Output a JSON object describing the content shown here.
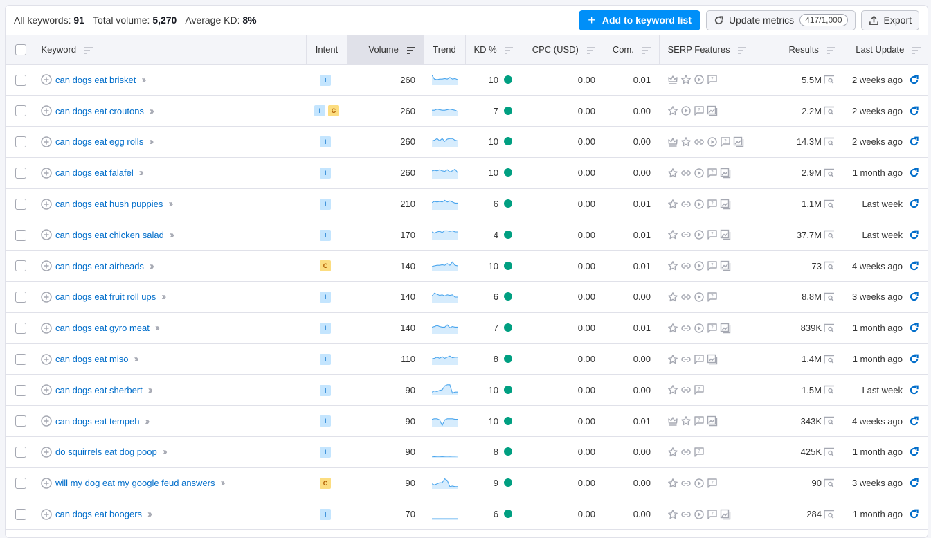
{
  "summary": {
    "all_keywords_label": "All keywords:",
    "all_keywords_value": "91",
    "total_volume_label": "Total volume:",
    "total_volume_value": "5,270",
    "avg_kd_label": "Average KD:",
    "avg_kd_value": "8%"
  },
  "actions": {
    "add_to_list": "Add to keyword list",
    "update_metrics": "Update metrics",
    "update_counter": "417/1,000",
    "export": "Export"
  },
  "columns": {
    "keyword": "Keyword",
    "intent": "Intent",
    "volume": "Volume",
    "trend": "Trend",
    "kd": "KD %",
    "cpc": "CPC (USD)",
    "com": "Com.",
    "serp": "SERP Features",
    "results": "Results",
    "last_update": "Last Update"
  },
  "sorted_column": "volume",
  "colors": {
    "accent": "#008ff8",
    "link": "#006dca",
    "kd_easy": "#009f81",
    "intent_informational_bg": "#c4e5fe",
    "intent_commercial_bg": "#fcdd80"
  },
  "rows": [
    {
      "keyword": "can dogs eat brisket",
      "intent": [
        "I"
      ],
      "volume": "260",
      "trend": [
        0.9,
        0.55,
        0.5,
        0.55,
        0.55,
        0.6,
        0.55,
        0.7,
        0.55,
        0.6,
        0.5
      ],
      "kd": "10",
      "cpc": "0.00",
      "com": "0.01",
      "serp": [
        "crown",
        "star",
        "play",
        "faq"
      ],
      "results": "5.5M",
      "last_update": "2 weeks ago"
    },
    {
      "keyword": "can dogs eat croutons",
      "intent": [
        "I",
        "C"
      ],
      "volume": "260",
      "trend": [
        0.55,
        0.55,
        0.65,
        0.6,
        0.55,
        0.55,
        0.6,
        0.65,
        0.6,
        0.55,
        0.45
      ],
      "kd": "7",
      "cpc": "0.00",
      "com": "0.00",
      "serp": [
        "star",
        "play",
        "faq",
        "image"
      ],
      "results": "2.2M",
      "last_update": "2 weeks ago"
    },
    {
      "keyword": "can dogs eat egg rolls",
      "intent": [
        "I"
      ],
      "volume": "260",
      "trend": [
        0.6,
        0.65,
        0.8,
        0.6,
        0.8,
        0.55,
        0.75,
        0.8,
        0.8,
        0.65,
        0.6
      ],
      "kd": "10",
      "cpc": "0.00",
      "com": "0.00",
      "serp": [
        "crown",
        "star",
        "link",
        "play",
        "faq",
        "image"
      ],
      "results": "14.3M",
      "last_update": "2 weeks ago"
    },
    {
      "keyword": "can dogs eat falafel",
      "intent": [
        "I"
      ],
      "volume": "260",
      "trend": [
        0.7,
        0.75,
        0.7,
        0.8,
        0.7,
        0.65,
        0.8,
        0.6,
        0.7,
        0.85,
        0.55
      ],
      "kd": "10",
      "cpc": "0.00",
      "com": "0.00",
      "serp": [
        "star",
        "link",
        "play",
        "faq",
        "image"
      ],
      "results": "2.9M",
      "last_update": "1 month ago"
    },
    {
      "keyword": "can dogs eat hush puppies",
      "intent": [
        "I"
      ],
      "volume": "210",
      "trend": [
        0.65,
        0.75,
        0.7,
        0.75,
        0.7,
        0.85,
        0.7,
        0.8,
        0.7,
        0.6,
        0.6
      ],
      "kd": "6",
      "cpc": "0.00",
      "com": "0.01",
      "serp": [
        "star",
        "link",
        "play",
        "faq",
        "image"
      ],
      "results": "1.1M",
      "last_update": "Last week"
    },
    {
      "keyword": "can dogs eat chicken salad",
      "intent": [
        "I"
      ],
      "volume": "170",
      "trend": [
        0.75,
        0.65,
        0.75,
        0.8,
        0.7,
        0.85,
        0.85,
        0.8,
        0.85,
        0.75,
        0.75
      ],
      "kd": "4",
      "cpc": "0.00",
      "com": "0.01",
      "serp": [
        "star",
        "link",
        "play",
        "faq",
        "image"
      ],
      "results": "37.7M",
      "last_update": "Last week"
    },
    {
      "keyword": "can dogs eat airheads",
      "intent": [
        "C"
      ],
      "volume": "140",
      "trend": [
        0.45,
        0.5,
        0.55,
        0.55,
        0.6,
        0.55,
        0.7,
        0.55,
        0.85,
        0.55,
        0.5
      ],
      "kd": "10",
      "cpc": "0.00",
      "com": "0.01",
      "serp": [
        "star",
        "link",
        "play",
        "faq",
        "image"
      ],
      "results": "73",
      "last_update": "4 weeks ago"
    },
    {
      "keyword": "can dogs eat fruit roll ups",
      "intent": [
        "I"
      ],
      "volume": "140",
      "trend": [
        0.6,
        0.85,
        0.75,
        0.65,
        0.7,
        0.6,
        0.7,
        0.65,
        0.7,
        0.5,
        0.5
      ],
      "kd": "6",
      "cpc": "0.00",
      "com": "0.00",
      "serp": [
        "star",
        "link",
        "play",
        "faq"
      ],
      "results": "8.8M",
      "last_update": "3 weeks ago"
    },
    {
      "keyword": "can dogs eat gyro meat",
      "intent": [
        "I"
      ],
      "volume": "140",
      "trend": [
        0.6,
        0.65,
        0.75,
        0.65,
        0.6,
        0.6,
        0.8,
        0.55,
        0.65,
        0.6,
        0.6
      ],
      "kd": "7",
      "cpc": "0.00",
      "com": "0.01",
      "serp": [
        "star",
        "link",
        "play",
        "faq",
        "image"
      ],
      "results": "839K",
      "last_update": "1 month ago"
    },
    {
      "keyword": "can dogs eat miso",
      "intent": [
        "I"
      ],
      "volume": "110",
      "trend": [
        0.55,
        0.6,
        0.7,
        0.6,
        0.75,
        0.6,
        0.7,
        0.8,
        0.65,
        0.7,
        0.7
      ],
      "kd": "8",
      "cpc": "0.00",
      "com": "0.00",
      "serp": [
        "star",
        "link",
        "faq",
        "image"
      ],
      "results": "1.4M",
      "last_update": "1 month ago"
    },
    {
      "keyword": "can dogs eat sherbert",
      "intent": [
        "I"
      ],
      "volume": "90",
      "trend": [
        0.3,
        0.4,
        0.35,
        0.45,
        0.5,
        0.85,
        0.95,
        0.95,
        0.2,
        0.3,
        0.3
      ],
      "kd": "10",
      "cpc": "0.00",
      "com": "0.00",
      "serp": [
        "star",
        "link",
        "faq"
      ],
      "results": "1.5M",
      "last_update": "Last week"
    },
    {
      "keyword": "can dogs eat tempeh",
      "intent": [
        "I"
      ],
      "volume": "90",
      "trend": [
        0.65,
        0.7,
        0.7,
        0.6,
        0.1,
        0.6,
        0.7,
        0.7,
        0.7,
        0.65,
        0.65
      ],
      "kd": "10",
      "cpc": "0.00",
      "com": "0.01",
      "serp": [
        "crown",
        "star",
        "faq",
        "image"
      ],
      "results": "343K",
      "last_update": "4 weeks ago"
    },
    {
      "keyword": "do squirrels eat dog poop",
      "intent": [
        "I"
      ],
      "volume": "90",
      "trend": [
        0.12,
        0.1,
        0.12,
        0.12,
        0.1,
        0.12,
        0.14,
        0.12,
        0.14,
        0.14,
        0.15
      ],
      "kd": "8",
      "cpc": "0.00",
      "com": "0.00",
      "serp": [
        "star",
        "link",
        "faq"
      ],
      "results": "425K",
      "last_update": "1 month ago"
    },
    {
      "keyword": "will my dog eat my google feud answers",
      "intent": [
        "C"
      ],
      "volume": "90",
      "trend": [
        0.45,
        0.35,
        0.45,
        0.55,
        0.55,
        0.9,
        0.75,
        0.2,
        0.25,
        0.2,
        0.2
      ],
      "kd": "9",
      "cpc": "0.00",
      "com": "0.00",
      "serp": [
        "star",
        "link",
        "play",
        "faq"
      ],
      "results": "90",
      "last_update": "3 weeks ago"
    },
    {
      "keyword": "can dogs eat boogers",
      "intent": [
        "I"
      ],
      "volume": "70",
      "trend": [
        0.12,
        0.12,
        0.12,
        0.12,
        0.12,
        0.12,
        0.12,
        0.12,
        0.12,
        0.12,
        0.12
      ],
      "kd": "6",
      "cpc": "0.00",
      "com": "0.00",
      "serp": [
        "star",
        "link",
        "play",
        "faq",
        "image"
      ],
      "results": "284",
      "last_update": "1 month ago"
    }
  ]
}
